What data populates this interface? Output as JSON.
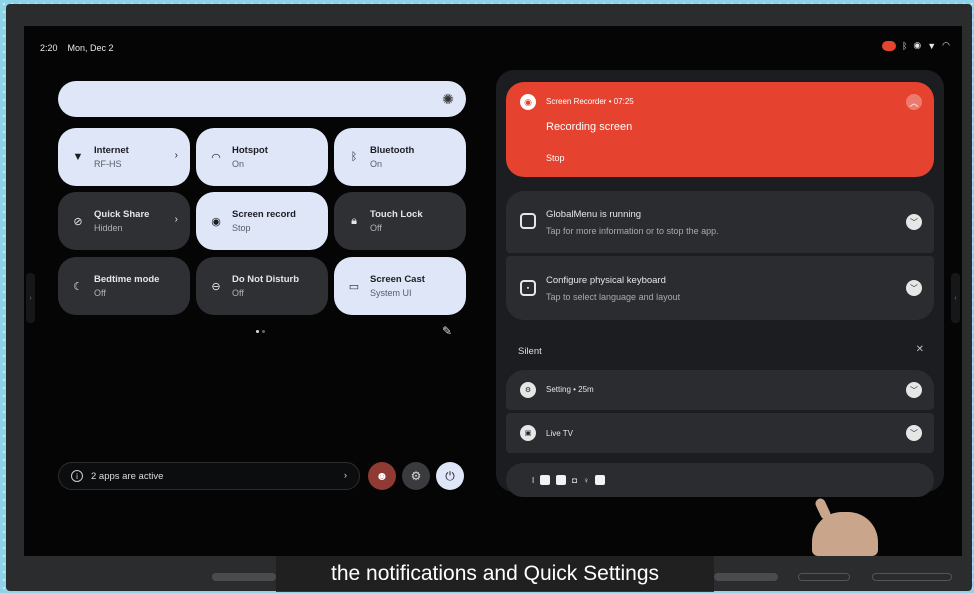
{
  "status": {
    "time": "2:20",
    "date": "Mon, Dec 2"
  },
  "tiles": [
    {
      "label": "Internet",
      "sub": "RF-HS",
      "icon": "wifi-icon",
      "glyph": "▼",
      "on": true,
      "chevron": true
    },
    {
      "label": "Hotspot",
      "sub": "On",
      "icon": "hotspot-icon",
      "glyph": "◠",
      "on": true,
      "chevron": false
    },
    {
      "label": "Bluetooth",
      "sub": "On",
      "icon": "bluetooth-icon",
      "glyph": "ᛒ",
      "on": true,
      "chevron": false
    },
    {
      "label": "Quick Share",
      "sub": "Hidden",
      "icon": "quick-share-icon",
      "glyph": "⊘",
      "on": false,
      "chevron": true
    },
    {
      "label": "Screen record",
      "sub": "Stop",
      "icon": "screen-record-icon",
      "glyph": "◉",
      "on": true,
      "chevron": false
    },
    {
      "label": "Touch Lock",
      "sub": "Off",
      "icon": "lock-icon",
      "glyph": "🔒︎",
      "on": false,
      "chevron": false
    },
    {
      "label": "Bedtime mode",
      "sub": "Off",
      "icon": "bedtime-icon",
      "glyph": "☾",
      "on": false,
      "chevron": false
    },
    {
      "label": "Do Not Disturb",
      "sub": "Off",
      "icon": "dnd-icon",
      "glyph": "⊖",
      "on": false,
      "chevron": false
    },
    {
      "label": "Screen Cast",
      "sub": "System UI",
      "icon": "cast-icon",
      "glyph": "▭",
      "on": true,
      "chevron": false
    }
  ],
  "active_apps": {
    "text": "2 apps are active"
  },
  "notifications": {
    "recorder": {
      "header": "Screen Recorder • 07:25",
      "title": "Recording screen",
      "action": "Stop"
    },
    "items": [
      {
        "title": "GlobalMenu is running",
        "sub": "Tap for more information or to stop the app."
      },
      {
        "title": "Configure physical keyboard",
        "sub": "Tap to select language and layout"
      }
    ],
    "silent_label": "Silent",
    "silent_items": [
      {
        "title": "Setting • 25m"
      },
      {
        "title": "Live TV"
      }
    ]
  },
  "caption": "the notifications and Quick Settings",
  "colors": {
    "accent_tile": "#dfe6f8",
    "recorder": "#e5422f",
    "panel": "#1c1d20"
  }
}
